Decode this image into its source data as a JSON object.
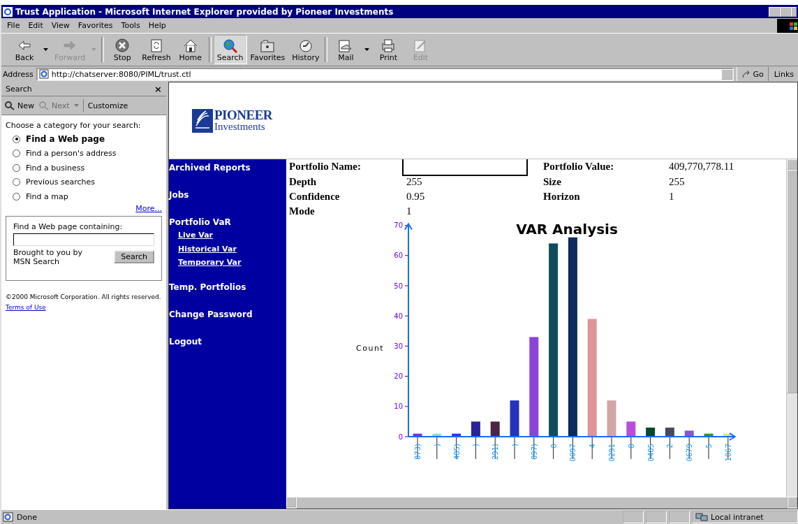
{
  "window": {
    "title": "Trust Application - Microsoft Internet Explorer provided by Pioneer Investments"
  },
  "menu": [
    "File",
    "Edit",
    "View",
    "Favorites",
    "Tools",
    "Help"
  ],
  "toolbar": [
    {
      "label": "Back",
      "kind": "back",
      "disabled": false,
      "selected": false,
      "dropdown": true
    },
    {
      "label": "Forward",
      "kind": "forward",
      "disabled": true,
      "selected": false,
      "dropdown": true
    },
    {
      "label": "Stop",
      "kind": "stop",
      "disabled": false,
      "selected": false,
      "dropdown": false
    },
    {
      "label": "Refresh",
      "kind": "refresh",
      "disabled": false,
      "selected": false,
      "dropdown": false
    },
    {
      "label": "Home",
      "kind": "home",
      "disabled": false,
      "selected": false,
      "dropdown": false
    },
    {
      "label": "Search",
      "kind": "search",
      "disabled": false,
      "selected": true,
      "dropdown": false
    },
    {
      "label": "Favorites",
      "kind": "favorites",
      "disabled": false,
      "selected": false,
      "dropdown": false
    },
    {
      "label": "History",
      "kind": "history",
      "disabled": false,
      "selected": false,
      "dropdown": false
    },
    {
      "label": "Mail",
      "kind": "mail",
      "disabled": false,
      "selected": false,
      "dropdown": true
    },
    {
      "label": "Print",
      "kind": "print",
      "disabled": false,
      "selected": false,
      "dropdown": false
    },
    {
      "label": "Edit",
      "kind": "edit",
      "disabled": true,
      "selected": false,
      "dropdown": false
    }
  ],
  "address": {
    "label": "Address",
    "value": "http://chatserver:8080/PIML/trust.ctl",
    "go": "Go",
    "links": "Links"
  },
  "search_pane": {
    "title": "Search",
    "close": "×",
    "new": "New",
    "next": "Next",
    "customize": "Customize",
    "prompt": "Choose a category for your search:",
    "options": [
      {
        "label": "Find a Web page",
        "selected": true
      },
      {
        "label": "Find a person's address",
        "selected": false
      },
      {
        "label": "Find a business",
        "selected": false
      },
      {
        "label": "Previous searches",
        "selected": false
      },
      {
        "label": "Find a map",
        "selected": false
      }
    ],
    "more": "More...",
    "box_label": "Find a Web page containing:",
    "brought_by": "Brought to you by MSN Search",
    "search_button": "Search",
    "copyright": "©2000 Microsoft Corporation. All rights reserved.",
    "terms": "Terms of Use"
  },
  "logo": {
    "name": "PIONEER",
    "sub": "Investments"
  },
  "nav": [
    {
      "label": "Archived Reports"
    },
    {
      "label": "Jobs"
    },
    {
      "label": "Portfolio VaR",
      "children": [
        {
          "label": "Live Var"
        },
        {
          "label": "Historical Var"
        },
        {
          "label": "Temporary Var"
        }
      ]
    },
    {
      "label": "Temp. Portfolios"
    },
    {
      "label": "Change Password"
    },
    {
      "label": "Logout"
    }
  ],
  "portfolio": [
    {
      "label": "Portfolio Name:",
      "label2": "Portfolio Value:",
      "value2": "409,770,778.11"
    },
    {
      "label": "Depth",
      "value": "255",
      "label2": "Size",
      "value2": "255"
    },
    {
      "label": "Confidence",
      "value": "0.95",
      "label2": "Horizon",
      "value2": "1"
    },
    {
      "label": "Mode",
      "value": "1"
    }
  ],
  "chart_data": {
    "type": "bar",
    "title": "VAR Analysis",
    "ylabel": "Count",
    "categories": [
      "873)",
      ")",
      "485)",
      ")",
      "291)",
      ")",
      "097)",
      "0",
      "0097",
      "4",
      "0291",
      "8",
      "0485",
      "2",
      "0679",
      "5",
      "1067"
    ],
    "series": [
      {
        "values": [
          1,
          1,
          1,
          5,
          5,
          12,
          33,
          64,
          66,
          39,
          12,
          5,
          3,
          3,
          2,
          1,
          1
        ],
        "colors": [
          "#7b2ee0",
          "#8fe0c8",
          "#3a2ef0",
          "#2a239a",
          "#4a2545",
          "#2433b8",
          "#8a45d6",
          "#0f4c5c",
          "#0e2a5e",
          "#e09498",
          "#d4a5a5",
          "#b84de0",
          "#0a4a2a",
          "#4a4a5e",
          "#8a55cc",
          "#2a9a1a",
          "#d8e878"
        ]
      }
    ],
    "ylim": [
      0,
      70
    ],
    "yticks": [
      0,
      10,
      20,
      30,
      40,
      50,
      60,
      70
    ]
  },
  "status": {
    "text": "Done",
    "zone": "Local intranet"
  }
}
